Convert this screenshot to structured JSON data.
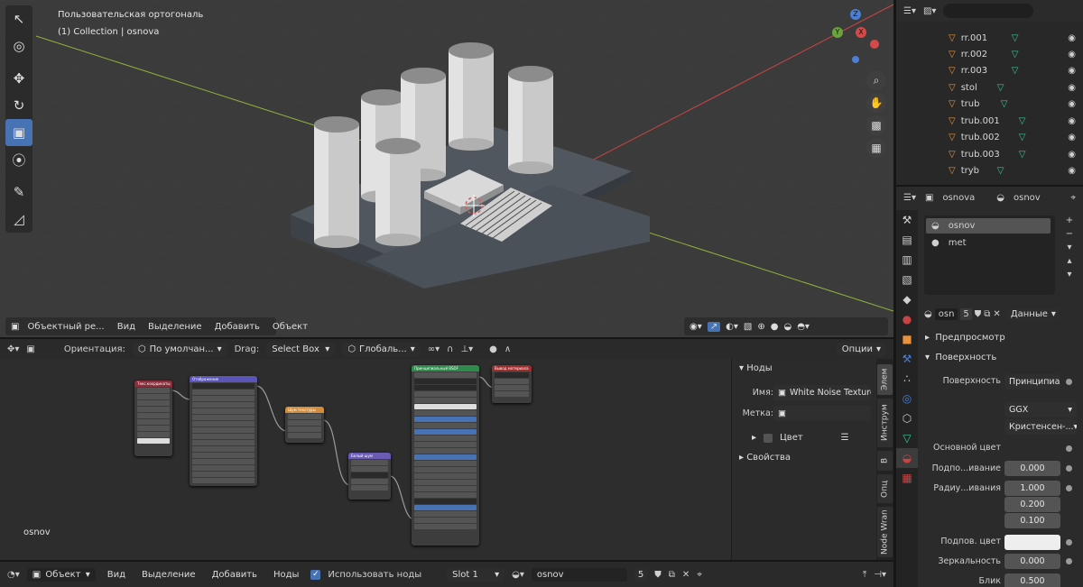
{
  "viewport": {
    "title": "Пользовательская ортогональ",
    "collection": "(1) Collection | osnova",
    "header": {
      "mode": "Объектный ре...",
      "menus": [
        "Вид",
        "Выделение",
        "Добавить",
        "Объект"
      ]
    },
    "toolbar": {
      "orientation_label": "Ориентация:",
      "orientation_value": "По умолчан...",
      "drag_label": "Drag:",
      "drag_value": "Select Box",
      "pivot_value": "Глобаль...",
      "options": "Опции"
    },
    "nav": {
      "x_label": "X",
      "y_label": "Y",
      "z_label": "Z"
    }
  },
  "node_editor": {
    "material_label": "osnov",
    "nodes": [
      {
        "title": "Текс.координаты",
        "color": "#8b2d3a"
      },
      {
        "title": "Отображение",
        "color": "#5a55b6"
      },
      {
        "title": "Шум текстуры",
        "color": "#d18e3e"
      },
      {
        "title": "Белый шум",
        "color": "#6b5bb5"
      },
      {
        "title": "Принципиальный BSDF",
        "color": "#2e8b4c"
      },
      {
        "title": "Вывод материала",
        "color": "#9b2d2d"
      }
    ]
  },
  "npanel": {
    "section_nodes": "Ноды",
    "name_label": "Имя:",
    "name_value": "White Noise Texture",
    "label_label": "Метка:",
    "color_label": "Цвет",
    "section_props": "Свойства",
    "tabs": [
      "Элем",
      "Инструм",
      "В",
      "Опц",
      "Node Wran"
    ]
  },
  "bottombar": {
    "mode": "Объект",
    "menus": [
      "Вид",
      "Выделение",
      "Добавить",
      "Ноды"
    ],
    "use_nodes_label": "Использовать ноды",
    "slot": "Slot 1",
    "material": "osnov",
    "users": "5"
  },
  "outliner": {
    "items": [
      "rr.001",
      "rr.002",
      "rr.003",
      "stol",
      "trub",
      "trub.001",
      "trub.002",
      "trub.003",
      "tryb"
    ]
  },
  "properties": {
    "object_name": "osnova",
    "material_name": "osnov",
    "slots": [
      "osnov",
      "met"
    ],
    "data_field": "osn",
    "data_users": "5",
    "data_link": "Данные",
    "section_preview": "Предпросмотр",
    "section_surface": "Поверхность",
    "surface_label": "Поверхность",
    "surface_value": "Принципиа...",
    "distribution": "GGX",
    "subsurface_method": "Кристенсен-...",
    "base_color_label": "Основной цвет",
    "subsurface_label": "Подпо...ивание",
    "subsurface_value": "0.000",
    "radius_label": "Радиу...ивания",
    "radius_values": [
      "1.000",
      "0.200",
      "0.100"
    ],
    "subsurface_color_label": "Подпов. цвет",
    "specular_label": "Зеркальность",
    "specular_value": "0.000",
    "next_label": "Блик",
    "next_value": "0.500"
  },
  "colors": {
    "accent": "#4772b3",
    "object_orange": "#e8923e",
    "mesh_green": "#38c79b",
    "axis_red": "#c84444",
    "axis_green": "#8fb33b"
  }
}
